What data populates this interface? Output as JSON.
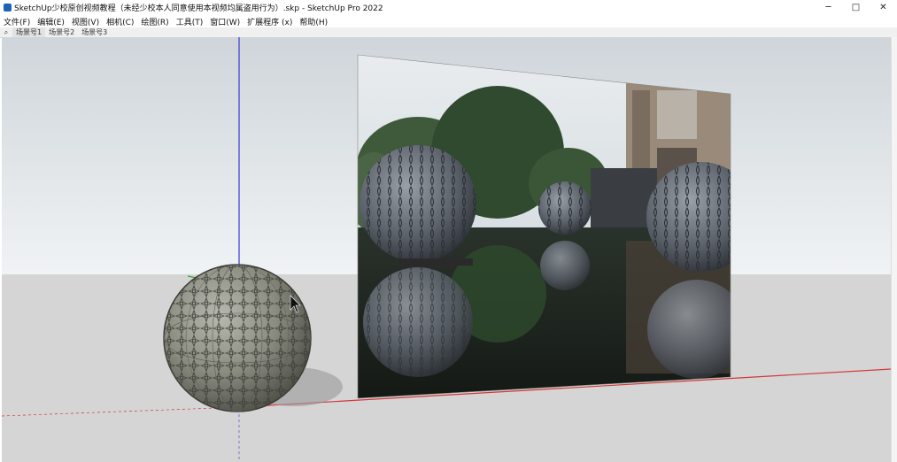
{
  "window": {
    "title": "SketchUp少校原创视频教程（未经少校本人同意使用本视频均属盗用行为）.skp - SketchUp Pro 2022",
    "controls": {
      "minimize": "─",
      "maximize": "□",
      "close": "✕"
    }
  },
  "menu": {
    "items": [
      "文件(F)",
      "编辑(E)",
      "视图(V)",
      "相机(C)",
      "绘图(R)",
      "工具(T)",
      "窗口(W)",
      "扩展程序 (x)",
      "帮助(H)"
    ]
  },
  "scenes": {
    "search_icon": "⌕",
    "tabs": [
      "场景号1",
      "场景号2",
      "场景号3"
    ]
  },
  "colors": {
    "axis_blue": "#3a3ad0",
    "axis_red": "#d43838",
    "axis_green": "#2eaa2e",
    "sphere": "#8a8c80"
  }
}
